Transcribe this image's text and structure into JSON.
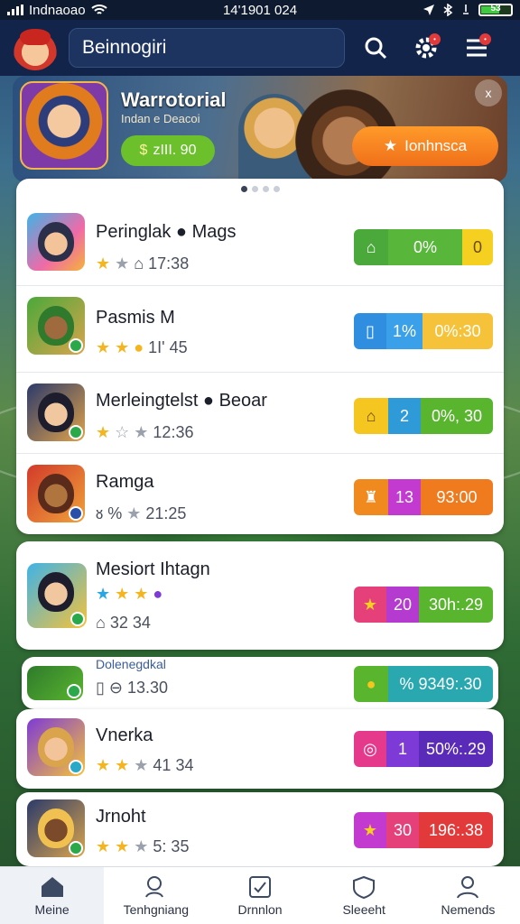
{
  "status": {
    "carrier": "Indnaoao",
    "time": "14'1901 024",
    "battery": "53"
  },
  "topbar": {
    "search_text": "Beinnogiri",
    "settings_badge": "•",
    "menu_badge": "•"
  },
  "hero": {
    "title": "Warrotorial",
    "subtitle": "Indan e Deacoi",
    "price": "zIII. 90",
    "cta_label": "Ionhnsca",
    "close_icon": "x"
  },
  "list1": {
    "rows": [
      {
        "name": "Peringlak ● Mags",
        "meta": "17:38",
        "stats": [
          "0%",
          "",
          ""
        ]
      },
      {
        "name": "Pasmis M",
        "meta": "1I' 45",
        "stats": [
          "1%",
          "0%:30"
        ]
      },
      {
        "name": "Merleingtelst ● Beoar",
        "meta": "12:36",
        "stats": [
          "",
          "2",
          "0%, 30"
        ]
      },
      {
        "name": "Ramga",
        "meta": "21:25",
        "stats": [
          "13",
          "93:00"
        ]
      }
    ]
  },
  "list2": {
    "rows": [
      {
        "name": "Mesiort Ihtagn",
        "meta": "32 34",
        "stats": [
          "20",
          "30h:.29"
        ]
      },
      {
        "tag": "Dolenegdkal",
        "meta": "13.30",
        "stats": [
          "%",
          "9349:.30"
        ]
      },
      {
        "name": "Vnerka",
        "meta": "41 34",
        "stats": [
          "1",
          "50%:.29"
        ]
      },
      {
        "name": "Jrnoht",
        "meta": "5: 35",
        "stats": [
          "30",
          "196:.38"
        ]
      }
    ]
  },
  "nav": [
    {
      "label": "Meine"
    },
    {
      "label": "Tenhgniang"
    },
    {
      "label": "Drnnlon"
    },
    {
      "label": "Sleeeht"
    },
    {
      "label": "Nemends"
    }
  ],
  "colors": {
    "green": "#59b52e",
    "blue": "#2f8ee0",
    "orange": "#f0921e",
    "purple": "#7e3ad6",
    "red": "#e23a3a",
    "pink": "#e53a8c",
    "yellow": "#f5c520"
  }
}
